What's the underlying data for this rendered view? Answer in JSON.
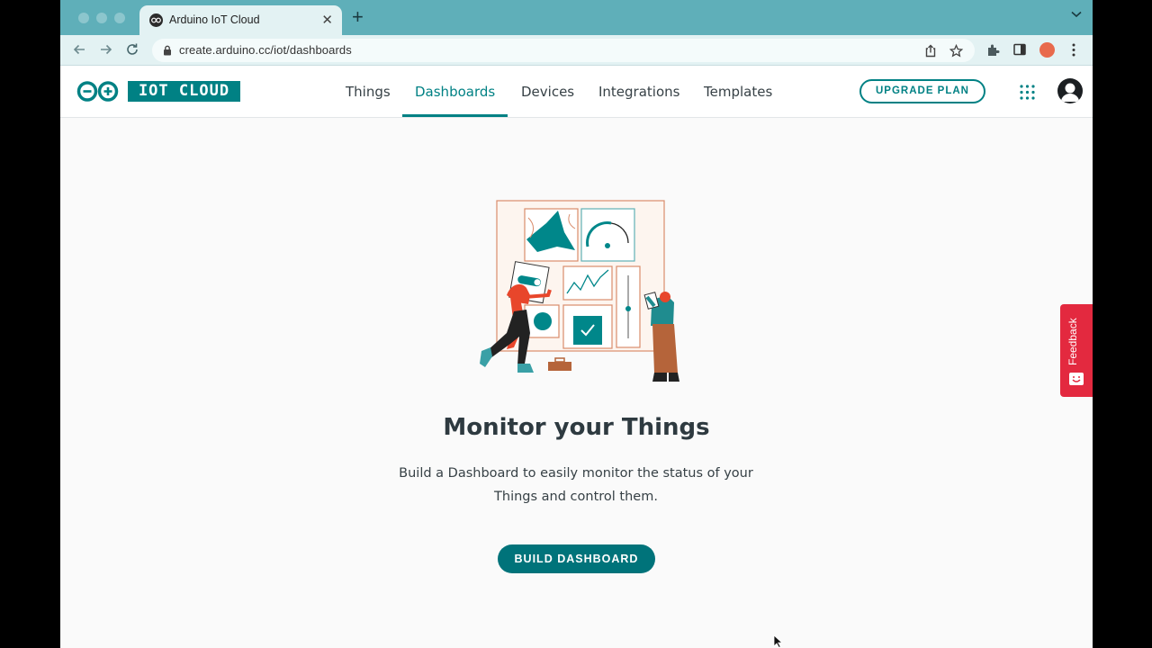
{
  "browser": {
    "tab_title": "Arduino IoT Cloud",
    "url": "create.arduino.cc/iot/dashboards"
  },
  "app": {
    "logo_text": "IOT CLOUD",
    "nav": [
      "Things",
      "Dashboards",
      "Devices",
      "Integrations",
      "Templates"
    ],
    "active_nav": "Dashboards",
    "upgrade_label": "UPGRADE PLAN"
  },
  "empty_state": {
    "title": "Monitor your Things",
    "description": "Build a Dashboard to easily monitor the status of your Things and control them.",
    "button_label": "BUILD DASHBOARD"
  },
  "feedback_label": "Feedback",
  "colors": {
    "accent": "#008184",
    "tab_strip": "#5fafb9",
    "feedback": "#e3293f"
  }
}
